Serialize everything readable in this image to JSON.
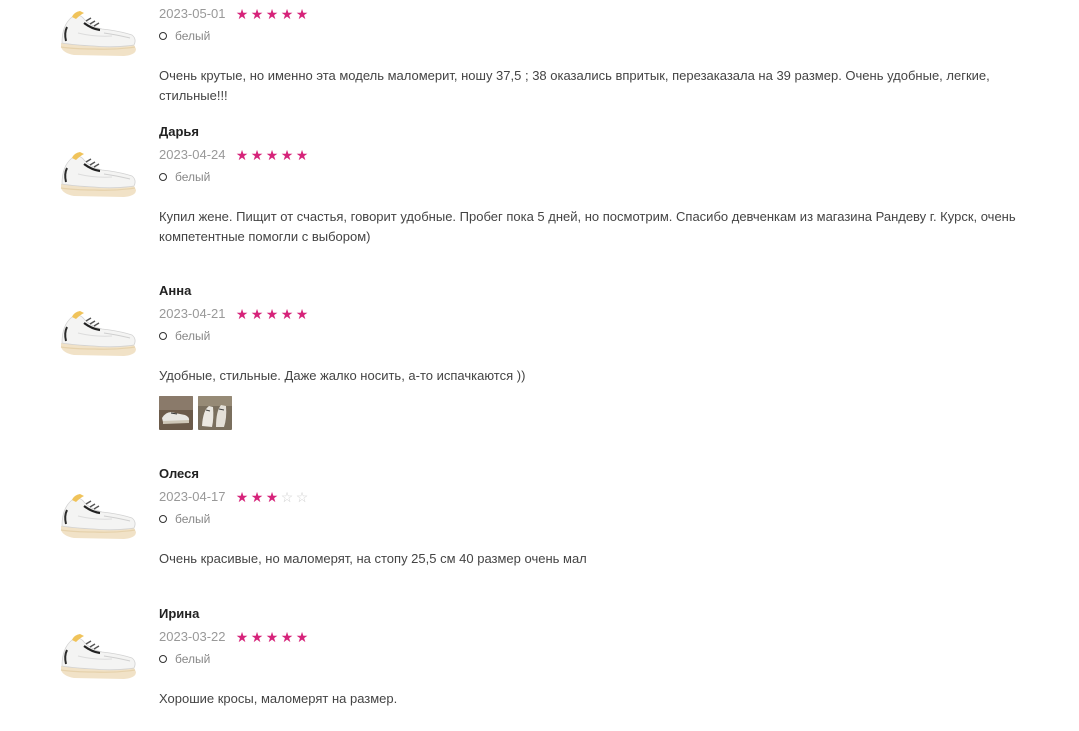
{
  "reviews": [
    {
      "name": "",
      "date": "2023-05-01",
      "rating": 5,
      "color": "белый",
      "text": "Очень крутые, но именно эта модель маломерит, ношу 37,5 ; 38 оказались впритык, перезаказала на 39 размер. Очень удобные, легкие, стильные!!!",
      "photos": []
    },
    {
      "name": "Дарья",
      "date": "2023-04-24",
      "rating": 5,
      "color": "белый",
      "text": "Купил жене. Пищит от счастья, говорит удобные. Пробег пока 5 дней, но посмотрим. Спасибо девченкам из магазина Рандеву г. Курск, очень компетентные помогли с выбором)",
      "photos": []
    },
    {
      "name": "Анна",
      "date": "2023-04-21",
      "rating": 5,
      "color": "белый",
      "text": "Удобные, стильные. Даже жалко носить, а-то испачкаются ))",
      "photos": [
        "photo-1",
        "photo-2"
      ]
    },
    {
      "name": "Олеся",
      "date": "2023-04-17",
      "rating": 3,
      "color": "белый",
      "text": "Очень красивые, но маломерят, на стопу 25,5 см 40 размер очень мал",
      "photos": []
    },
    {
      "name": "Ирина",
      "date": "2023-03-22",
      "rating": 5,
      "color": "белый",
      "text": "Хорошие кросы, маломерят на размер.",
      "photos": []
    }
  ],
  "colors": {
    "star_active": "#d6237a",
    "star_inactive": "#cfcfcf"
  },
  "icons": {
    "star": "star-icon",
    "color_dot": "color-dot-icon",
    "product": "sneaker-image"
  }
}
